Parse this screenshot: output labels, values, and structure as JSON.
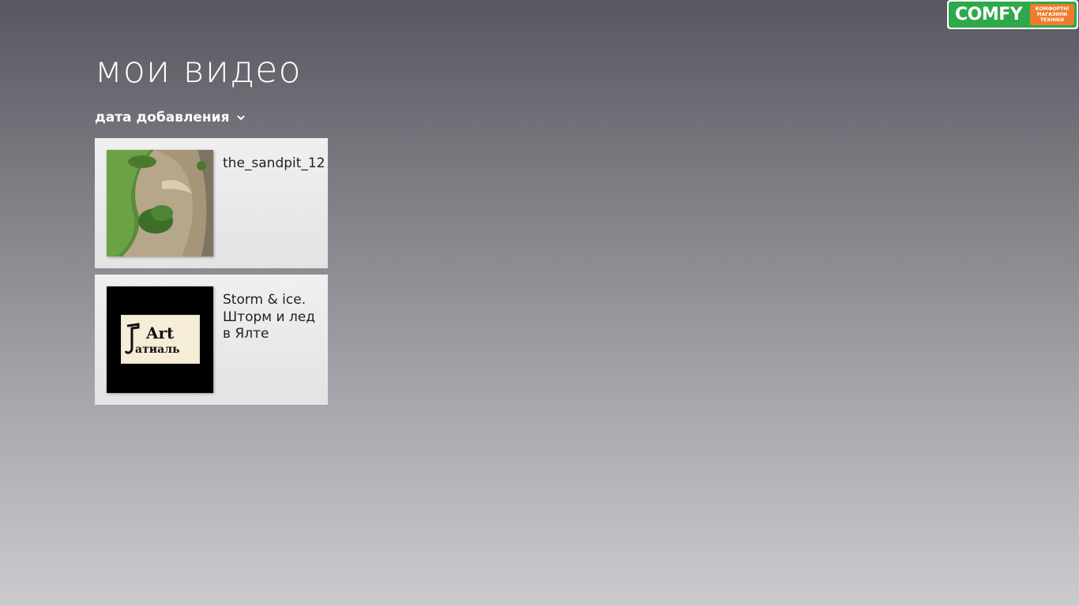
{
  "header": {
    "title": "мои видео",
    "sort_label": "дата добавления"
  },
  "videos": [
    {
      "title": "the_sandpit_12"
    },
    {
      "title": "Storm & ice.\nШторм и лед\nв Ялте",
      "thumb_text": "Art",
      "thumb_text2": "атиаль"
    }
  ],
  "logo": {
    "word": "COMFY",
    "tag_line1": "КОМФОРТНІ",
    "tag_line2": "МАГАЗИНИ",
    "tag_line3": "ТЕХНІКИ"
  },
  "colors": {
    "accent_green": "#2ea84a",
    "accent_orange": "#f07b2c"
  }
}
